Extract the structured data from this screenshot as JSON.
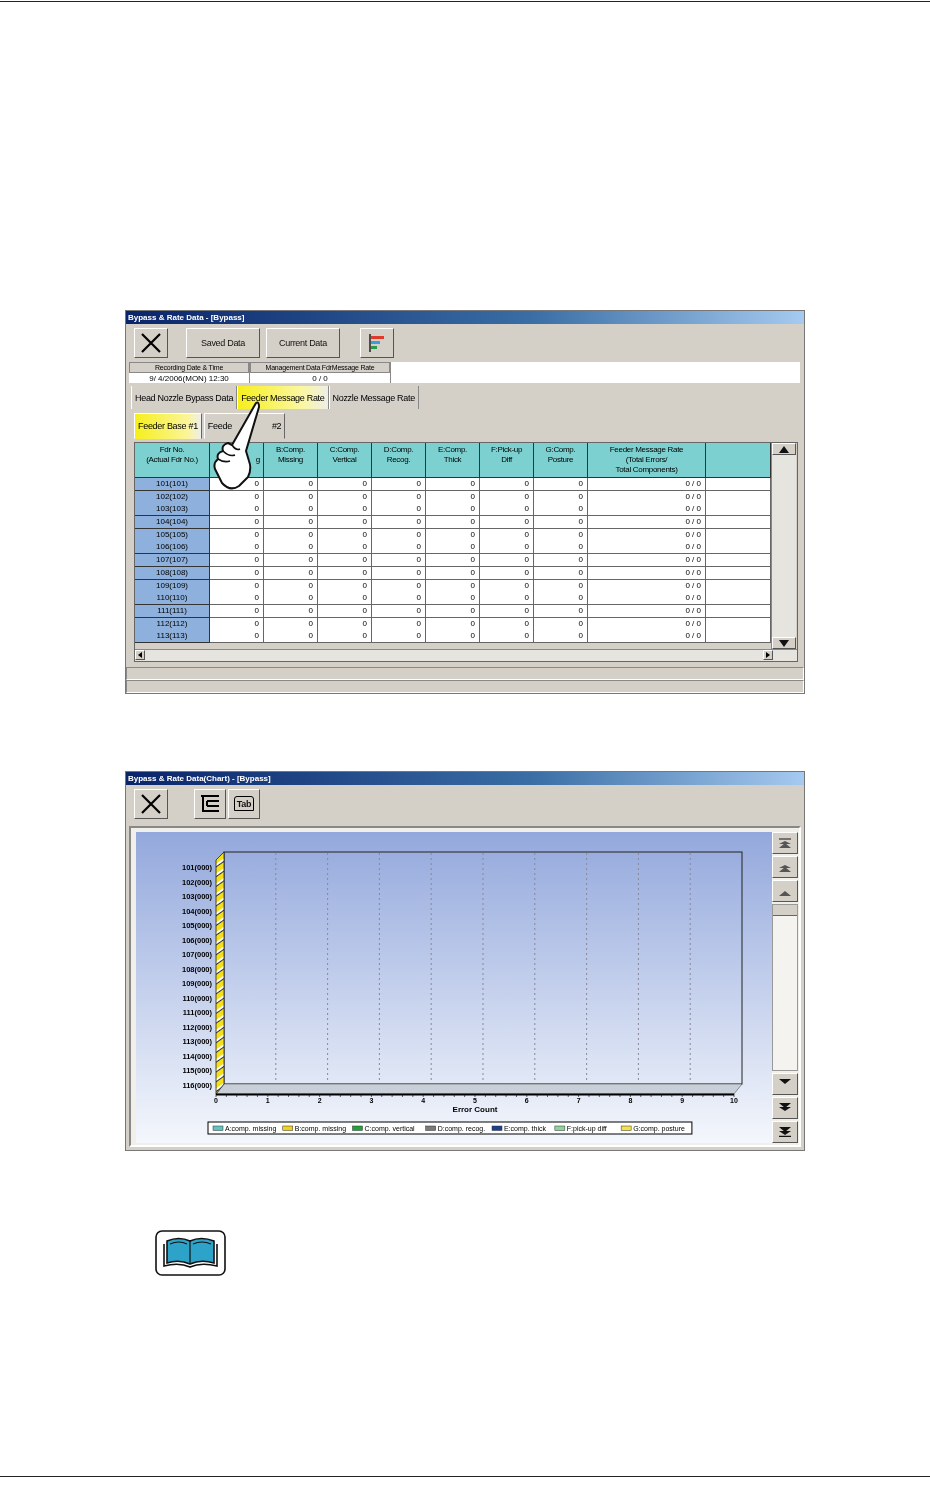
{
  "data_window": {
    "title": "Bypass & Rate Data - [Bypass]",
    "toolbar": [
      {
        "kind": "close"
      },
      {
        "kind": "text",
        "label": "Saved Data"
      },
      {
        "kind": "text",
        "label": "Current Data"
      },
      {
        "kind": "chart"
      }
    ],
    "info": [
      {
        "label": "Recording Date & Time",
        "value": "9/ 4/2006(MON) 12:30"
      },
      {
        "label": "Management Data FdrMessage Rate",
        "value": "0 / 0"
      }
    ],
    "tabs": [
      {
        "label": "Head Nozzle Bypass Data",
        "selected": false
      },
      {
        "label": "Feeder Message Rate",
        "selected": true
      },
      {
        "label": "Nozzle Message Rate",
        "selected": false
      }
    ],
    "subtabs": [
      {
        "label_parts": [
          "Feeder Base #1"
        ],
        "selected": true
      },
      {
        "label_parts": [
          "Feede",
          "#2"
        ],
        "selected": false
      }
    ],
    "table": {
      "columns": [
        "Fdr No.\n(Actual Fdr No.)",
        "g",
        "B:Comp.\nMissing",
        "C:Comp.\nVertical",
        "D:Comp.\nRecog.",
        "E:Comp.\nThick",
        "F:Pick-up\nDiff",
        "G:Comp.\nPosture",
        "Feeder Message Rate\n(Total Errors/\nTotal Components)"
      ],
      "rows": [
        {
          "cells": [
            "101(101)",
            "0",
            "0",
            "0",
            "0",
            "0",
            "0",
            "0",
            "0 / 0"
          ]
        },
        {
          "cells": [
            "102(102)",
            "0",
            "0",
            "0",
            "0",
            "0",
            "0",
            "0",
            "0 / 0"
          ]
        },
        {
          "cells": [
            "103(103)",
            "0",
            "0",
            "0",
            "0",
            "0",
            "0",
            "0",
            "0 / 0"
          ]
        },
        {
          "cells": [
            "104(104)",
            "0",
            "0",
            "0",
            "0",
            "0",
            "0",
            "0",
            "0 / 0"
          ]
        },
        {
          "cells": [
            "105(105)",
            "0",
            "0",
            "0",
            "0",
            "0",
            "0",
            "0",
            "0 / 0"
          ]
        },
        {
          "cells": [
            "106(106)",
            "0",
            "0",
            "0",
            "0",
            "0",
            "0",
            "0",
            "0 / 0"
          ]
        },
        {
          "cells": [
            "107(107)",
            "0",
            "0",
            "0",
            "0",
            "0",
            "0",
            "0",
            "0 / 0"
          ]
        },
        {
          "cells": [
            "108(108)",
            "0",
            "0",
            "0",
            "0",
            "0",
            "0",
            "0",
            "0 / 0"
          ]
        },
        {
          "cells": [
            "109(109)",
            "0",
            "0",
            "0",
            "0",
            "0",
            "0",
            "0",
            "0 / 0"
          ]
        },
        {
          "cells": [
            "110(110)",
            "0",
            "0",
            "0",
            "0",
            "0",
            "0",
            "0",
            "0 / 0"
          ]
        },
        {
          "cells": [
            "111(111)",
            "0",
            "0",
            "0",
            "0",
            "0",
            "0",
            "0",
            "0 / 0"
          ]
        },
        {
          "cells": [
            "112(112)",
            "0",
            "0",
            "0",
            "0",
            "0",
            "0",
            "0",
            "0 / 0"
          ]
        },
        {
          "cells": [
            "113(113)",
            "0",
            "0",
            "0",
            "0",
            "0",
            "0",
            "0",
            "0 / 0"
          ]
        }
      ]
    }
  },
  "chart_window": {
    "title": "Bypass & Rate Data(Chart) - [Bypass]",
    "toolbar": [
      {
        "kind": "close"
      },
      {
        "kind": "tree"
      },
      {
        "kind": "tab",
        "label": "Tab"
      }
    ],
    "chart_data": {
      "type": "bar",
      "orientation": "horizontal",
      "xlabel": "Error Count",
      "xlim": [
        0,
        10
      ],
      "xticks": [
        0,
        1,
        2,
        3,
        4,
        5,
        6,
        7,
        8,
        9,
        10
      ],
      "categories": [
        "101(000)",
        "102(000)",
        "103(000)",
        "104(000)",
        "105(000)",
        "106(000)",
        "107(000)",
        "108(000)",
        "109(000)",
        "110(000)",
        "111(000)",
        "112(000)",
        "113(000)",
        "114(000)",
        "115(000)",
        "116(000)"
      ],
      "series": [
        {
          "name": "A:comp. missing",
          "color": "#5fc4c0",
          "values": [
            0,
            0,
            0,
            0,
            0,
            0,
            0,
            0,
            0,
            0,
            0,
            0,
            0,
            0,
            0,
            0
          ]
        },
        {
          "name": "B:comp. missing",
          "color": "#f2d21a",
          "values": [
            0,
            0,
            0,
            0,
            0,
            0,
            0,
            0,
            0,
            0,
            0,
            0,
            0,
            0,
            0,
            0
          ]
        },
        {
          "name": "C:comp. vertical",
          "color": "#1fa33a",
          "values": [
            0,
            0,
            0,
            0,
            0,
            0,
            0,
            0,
            0,
            0,
            0,
            0,
            0,
            0,
            0,
            0
          ]
        },
        {
          "name": "D:comp. recog.",
          "color": "#7a7a7a",
          "values": [
            0,
            0,
            0,
            0,
            0,
            0,
            0,
            0,
            0,
            0,
            0,
            0,
            0,
            0,
            0,
            0
          ]
        },
        {
          "name": "E:comp. thick",
          "color": "#1b3f8f",
          "values": [
            0,
            0,
            0,
            0,
            0,
            0,
            0,
            0,
            0,
            0,
            0,
            0,
            0,
            0,
            0,
            0
          ]
        },
        {
          "name": "F:pick-up diff",
          "color": "#8fd49a",
          "values": [
            0,
            0,
            0,
            0,
            0,
            0,
            0,
            0,
            0,
            0,
            0,
            0,
            0,
            0,
            0,
            0
          ]
        },
        {
          "name": "G:comp. posture",
          "color": "#f5e24a",
          "values": [
            0,
            0,
            0,
            0,
            0,
            0,
            0,
            0,
            0,
            0,
            0,
            0,
            0,
            0,
            0,
            0
          ]
        }
      ]
    }
  }
}
